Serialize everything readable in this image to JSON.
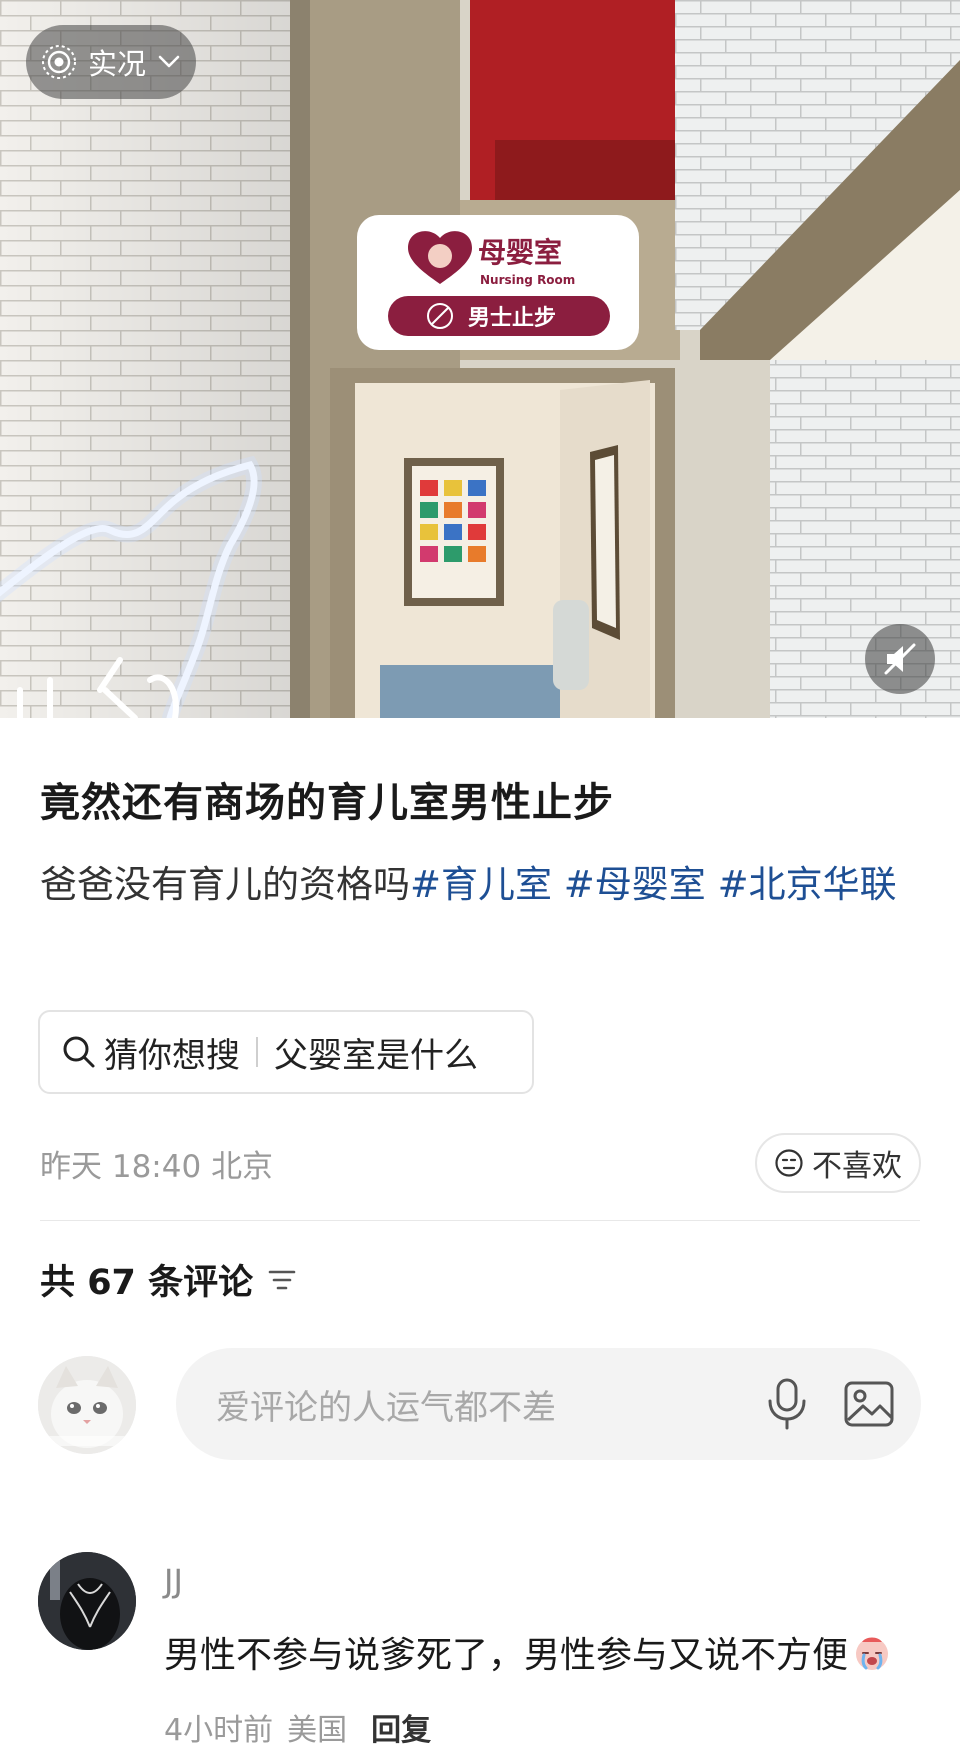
{
  "photo": {
    "live_label": "实况",
    "sign_title": "母婴室",
    "sign_subtitle": "Nursing Room",
    "sign_warning": "男士止步"
  },
  "post": {
    "title": "竟然还有商场的育儿室男性止步",
    "desc_text": "爸爸没有育儿的资格吗",
    "tags": [
      "#育儿室",
      "#母婴室",
      "#北京华联"
    ],
    "suggest_prefix": "猜你想搜",
    "suggest_query": "父婴室是什么",
    "time": "昨天 18:40",
    "location": "北京",
    "dislike_label": "不喜欢"
  },
  "comments": {
    "count_prefix": "共",
    "count": "67",
    "count_suffix": "条评论",
    "input_placeholder": "爱评论的人运气都不差",
    "items": [
      {
        "name": "JJ",
        "text": "男性不参与说爹死了，男性参与又说不方便",
        "time": "4小时前",
        "location": "美国",
        "reply_label": "回复"
      }
    ]
  },
  "icons": {
    "live": "live-photo-icon",
    "chevron": "chevron-down-icon",
    "mute": "speaker-muted-icon",
    "search": "search-icon",
    "dislike": "neutral-face-icon",
    "sort": "sort-lines-icon",
    "mic": "microphone-icon",
    "image": "image-icon",
    "emoji": "crying-face-emoji"
  },
  "colors": {
    "tag": "#1e4f94",
    "sign_red": "#8b1e3f",
    "pillar_red": "#b01f24"
  }
}
